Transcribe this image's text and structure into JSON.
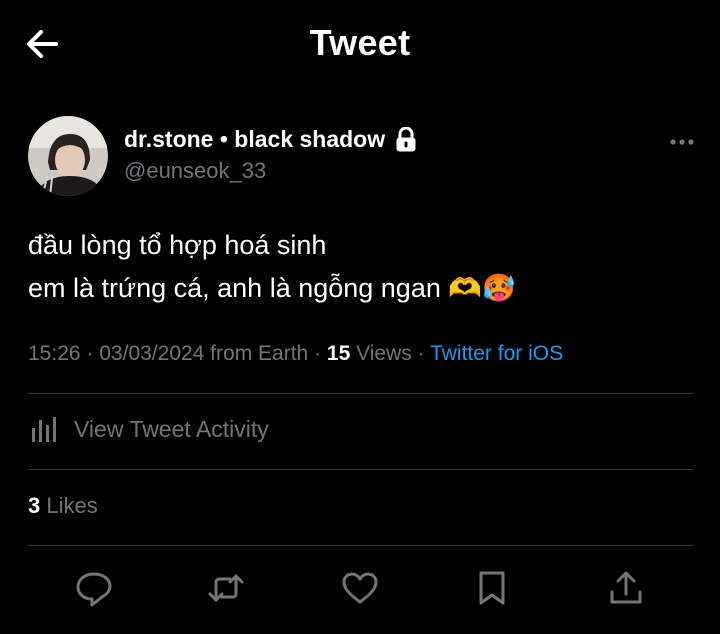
{
  "header": {
    "title": "Tweet"
  },
  "author": {
    "display_name": "dr.stone • black shadow",
    "handle": "@eunseok_33"
  },
  "tweet": {
    "lines": [
      "đầu lòng tổ hợp hoá sinh",
      "em là trứng cá, anh là ngỗng ngan 🫶🥵"
    ]
  },
  "meta": {
    "time": "15:26",
    "date_location": "03/03/2024 from Earth",
    "views_count": "15",
    "views_label": "Views",
    "source": "Twitter for iOS",
    "separator": "·"
  },
  "activity": {
    "label": "View Tweet Activity"
  },
  "likes": {
    "count": "3",
    "label": "Likes"
  },
  "actions": [
    "reply-icon",
    "retweet-icon",
    "like-icon",
    "bookmark-icon",
    "share-icon"
  ],
  "colors": {
    "background": "#000000",
    "text": "#e7e9ea",
    "muted": "#71767b",
    "accent": "#1d9bf0",
    "divider": "#2f3336"
  }
}
